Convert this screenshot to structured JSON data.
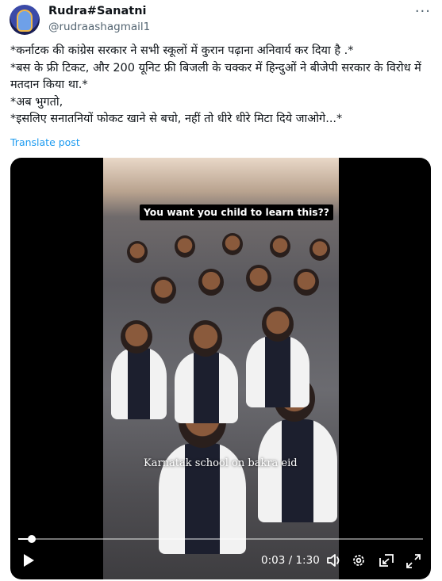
{
  "author": {
    "display_name": "Rudra#Sanatni",
    "handle": "@rudraashagmail1",
    "avatar_icon": "deity-avatar-icon"
  },
  "more_icon": "more-options-icon",
  "more_glyph": "···",
  "tweet": {
    "lines": [
      "*कर्नाटक की कांग्रेस सरकार ने सभी स्कूलों में कुरान पढ़ाना अनिवार्य कर दिया है .*",
      " *बस के फ्री टिकट, और 200 यूनिट फ्री बिजली के चक्कर में हिन्दुओं ने बीजेपी सरकार के विरोध में मतदान किया था.*",
      " *अब भुगतो,",
      " *इसलिए सनातनियों फोकट खाने से बचो, नहीं तो धीरे धीरे मिटा दिये जाओगे...*"
    ],
    "translate_label": "Translate post"
  },
  "video": {
    "top_caption": "You want you child to learn this??",
    "overlay_text": "Karnatak school on bakra eid",
    "current_time": "0:03",
    "separator": " / ",
    "duration": "1:30",
    "progress_fraction": 0.033,
    "controls": {
      "play": "play-icon",
      "volume": "volume-icon",
      "settings": "settings-gear-icon",
      "pip": "picture-in-picture-icon",
      "fullscreen": "fullscreen-icon"
    }
  },
  "colors": {
    "link": "#1d9bf0",
    "secondary_text": "#536471",
    "primary_text": "#0f1419"
  }
}
